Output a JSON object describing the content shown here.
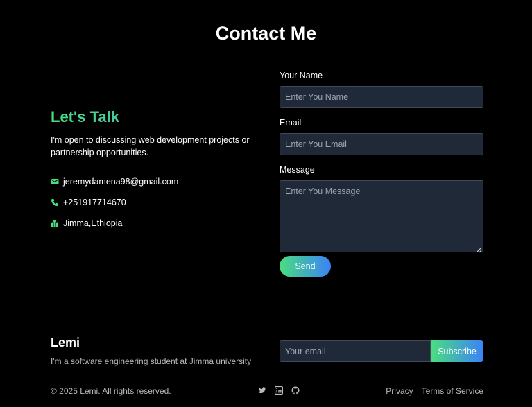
{
  "header": {
    "title": "Contact Me"
  },
  "intro": {
    "heading": "Let's Talk",
    "text": "I'm open to discussing web development projects or partnership opportunities.",
    "contacts": [
      {
        "icon": "envelope-icon",
        "text": "jeremydamena98@gmail.com"
      },
      {
        "icon": "phone-icon",
        "text": "+251917714670"
      },
      {
        "icon": "map-icon",
        "text": "Jimma,Ethiopia"
      }
    ]
  },
  "form": {
    "name_label": "Your Name",
    "name_placeholder": "Enter You Name",
    "email_label": "Email",
    "email_placeholder": "Enter You Email",
    "message_label": "Message",
    "message_placeholder": "Enter You Message",
    "send_label": "Send"
  },
  "footer": {
    "brand": "Lemi",
    "description": "I'm a software engineering student at Jimma university",
    "email_placeholder": "Your email",
    "subscribe_label": "Subscribe",
    "copyright": "© 2025 Lemi. All rights reserved.",
    "social": [
      "twitter-icon",
      "linkedin-icon",
      "github-icon"
    ],
    "links": {
      "privacy": "Privacy",
      "terms": "Terms of Service"
    }
  },
  "colors": {
    "accent_green": "#4ade80",
    "accent_blue": "#3b82f6",
    "input_bg": "#1f2937",
    "page_bg": "#000000"
  }
}
